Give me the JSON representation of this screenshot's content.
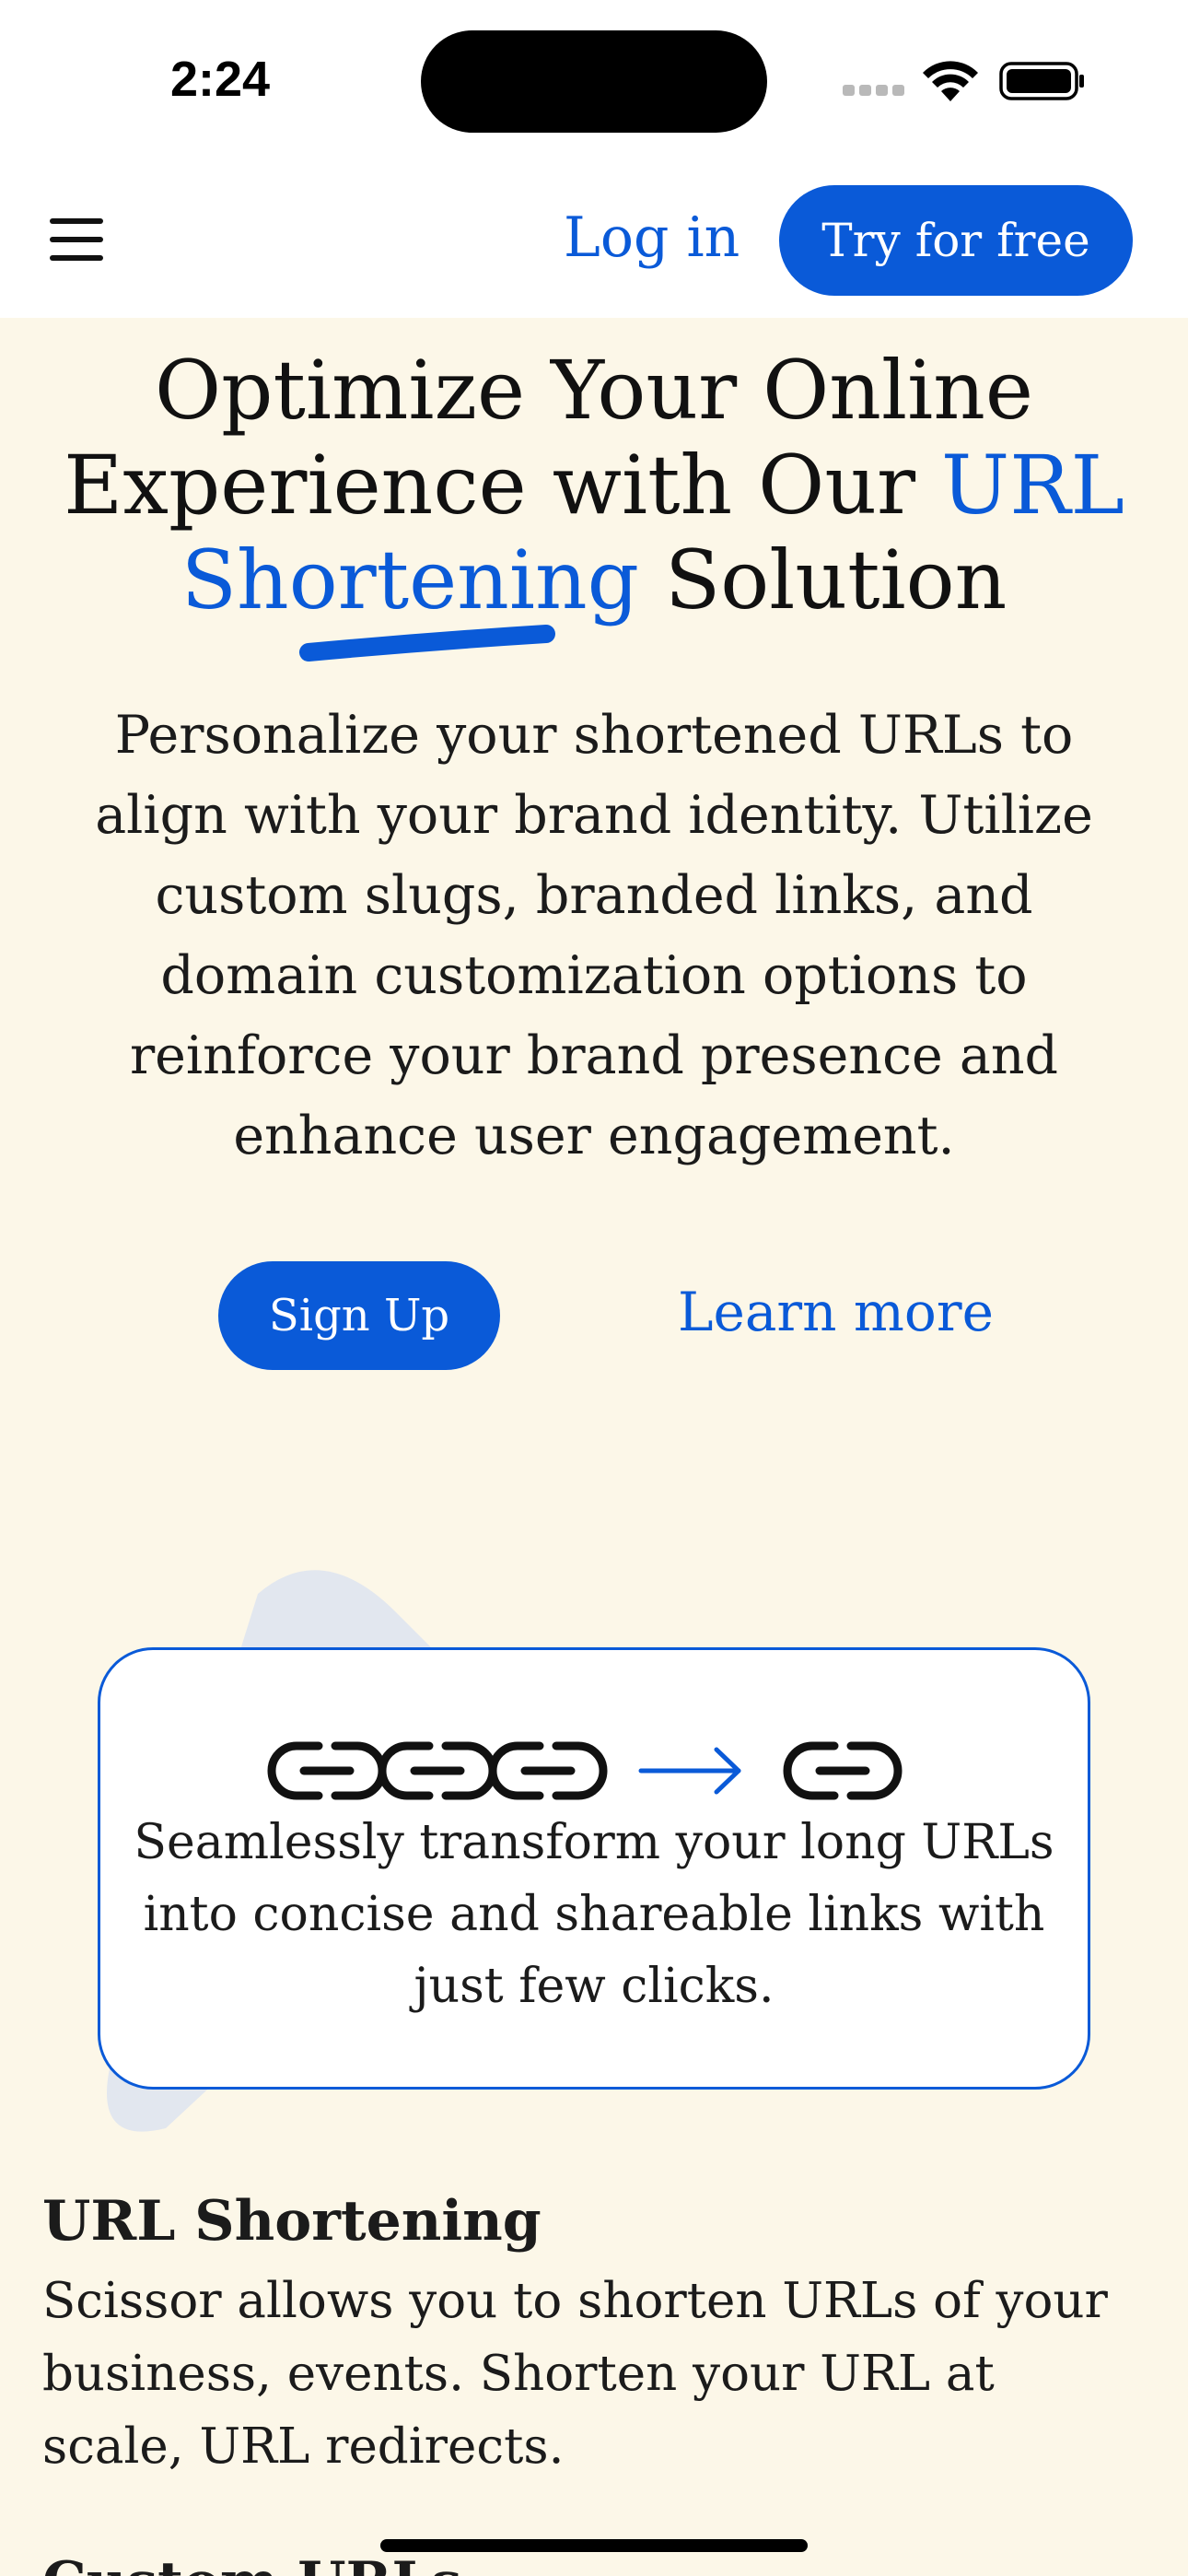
{
  "status_bar": {
    "time": "2:24",
    "icons": [
      "cellular-signal-icon",
      "wifi-icon",
      "battery-icon"
    ]
  },
  "header": {
    "menu_icon": "hamburger-menu-icon",
    "login_label": "Log in",
    "try_label": "Try for free"
  },
  "hero": {
    "title_part1": "Optimize Your Online Experience with Our ",
    "title_accent": "URL Shortening",
    "title_part2": " Solution",
    "description": "Personalize your shortened URLs to align with your brand identity. Utilize custom slugs, branded links, and domain customization options to reinforce your brand presence and enhance user engagement.",
    "signup_label": "Sign Up",
    "learn_more_label": "Learn more"
  },
  "feature_card": {
    "icons": [
      "long-chain-link-icon",
      "arrow-right-icon",
      "short-link-icon"
    ],
    "text": "Seamlessly transform your long URLs into concise and shareable links with just few clicks."
  },
  "section": {
    "title": "URL Shortening",
    "text": "Scissor allows you to shorten URLs of your business, events. Shorten your URL at scale, URL redirects.",
    "next_title": "Custom URLs"
  },
  "colors": {
    "accent": "#0a5ad8",
    "background": "#fcf7e8",
    "shape": "#e2e7ef"
  }
}
